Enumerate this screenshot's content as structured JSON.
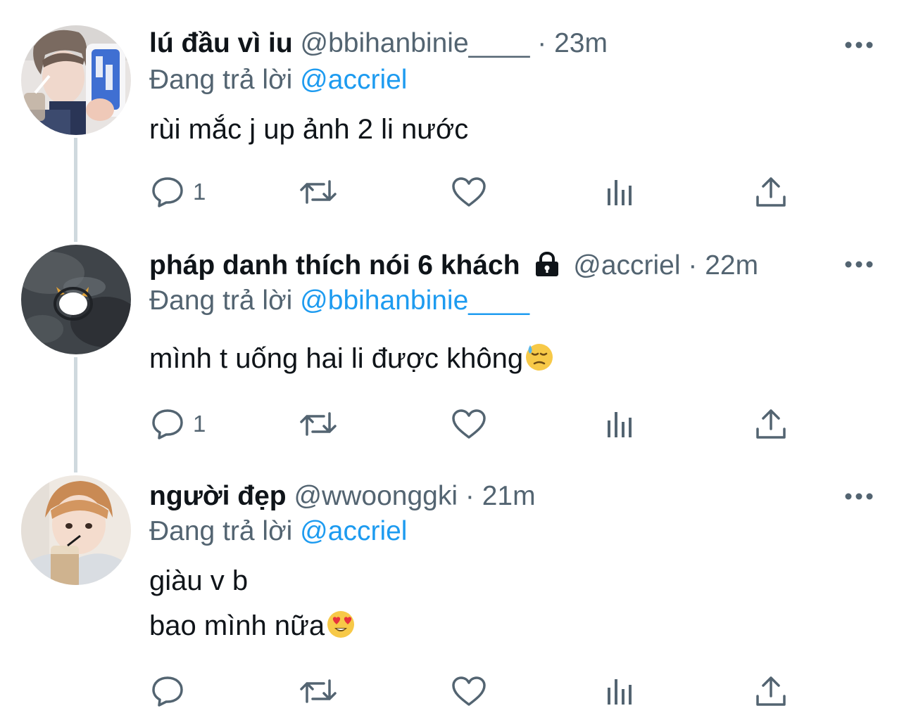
{
  "colors": {
    "text_primary": "#0f1419",
    "text_secondary": "#536471",
    "accent": "#1d9bf0",
    "thread_line": "#cfd9de"
  },
  "tweets": [
    {
      "display_name": "lú đầu vì iu",
      "handle": "@bbihanbinie____",
      "separator": "·",
      "time": "23m",
      "locked": false,
      "reply_prefix": "Đang trả lời",
      "reply_to": "@accriel",
      "lines": [
        "rùi mắc j up ảnh 2 li nước"
      ],
      "reply_count": "1",
      "icons": [
        "reply-icon",
        "retweet-icon",
        "like-icon",
        "views-icon",
        "share-icon"
      ]
    },
    {
      "display_name": "pháp danh thích nói 6 khách",
      "handle": "@accriel",
      "separator": "·",
      "time": "22m",
      "locked": true,
      "reply_prefix": "Đang trả lời",
      "reply_to": "@bbihanbinie____",
      "lines": [
        "mình t uống hai li được không"
      ],
      "emoji": "downcast-face-with-sweat-emoji",
      "reply_count": "1",
      "icons": [
        "reply-icon",
        "retweet-icon",
        "like-icon",
        "views-icon",
        "share-icon"
      ]
    },
    {
      "display_name": "người đẹp",
      "handle": "@wwoonggki",
      "separator": "·",
      "time": "21m",
      "locked": false,
      "reply_prefix": "Đang trả lời",
      "reply_to": "@accriel",
      "lines": [
        "giàu v b",
        "bao mình nữa"
      ],
      "emoji": "heart-eyes-emoji",
      "reply_count": "",
      "icons": [
        "reply-icon",
        "retweet-icon",
        "like-icon",
        "views-icon",
        "share-icon"
      ]
    }
  ]
}
